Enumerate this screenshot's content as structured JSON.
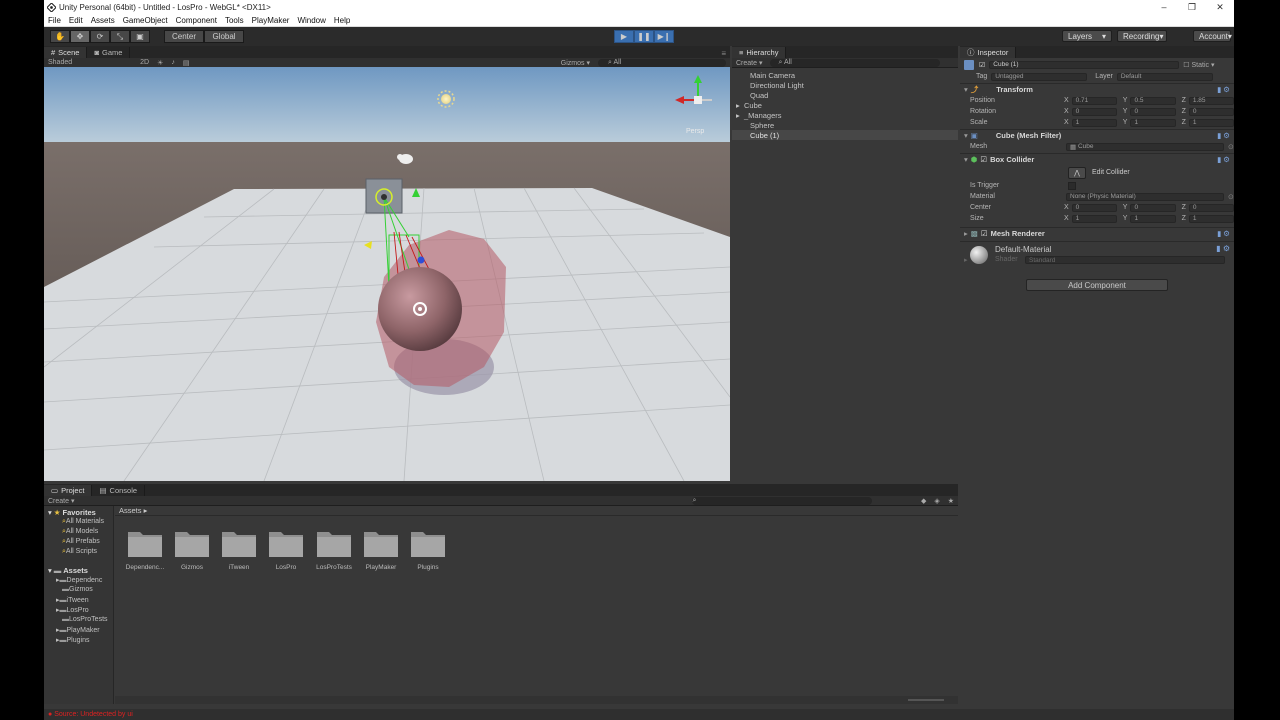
{
  "app": {
    "title": "Unity Personal (64bit) - Untitled - LosPro - WebGL* <DX11>"
  },
  "menu": [
    "File",
    "Edit",
    "Assets",
    "GameObject",
    "Component",
    "Tools",
    "PlayMaker",
    "Window",
    "Help"
  ],
  "toolbar": {
    "pivot_label": "Center",
    "space_label": "Global",
    "layers_label": "Layers",
    "layout_label": "Recording",
    "account_label": "Account"
  },
  "scene_panel": {
    "tab_scene": "Scene",
    "tab_game": "Game",
    "shading": "Shaded",
    "mode_2d": "2D",
    "gizmos_label": "Gizmos",
    "search_text": "All",
    "persp_label": "Persp"
  },
  "hierarchy": {
    "tab": "Hierarchy",
    "create_label": "Create",
    "search_text": "All",
    "items": [
      {
        "label": "Main Camera",
        "arrow": "",
        "selected": false
      },
      {
        "label": "Directional Light",
        "arrow": "",
        "selected": false
      },
      {
        "label": "Quad",
        "arrow": "",
        "selected": false
      },
      {
        "label": "Cube",
        "arrow": "▸",
        "selected": false
      },
      {
        "label": "_Managers",
        "arrow": "▸",
        "selected": false
      },
      {
        "label": "Sphere",
        "arrow": "",
        "selected": false
      },
      {
        "label": "Cube (1)",
        "arrow": "",
        "selected": true
      }
    ]
  },
  "inspector": {
    "tab": "Inspector",
    "object_name": "Cube (1)",
    "static_label": "Static",
    "tag_label": "Tag",
    "tag_value": "Untagged",
    "layer_label": "Layer",
    "layer_value": "Default",
    "transform": {
      "title": "Transform",
      "position_label": "Position",
      "rotation_label": "Rotation",
      "scale_label": "Scale",
      "position": {
        "x": "0.71",
        "y": "0.5",
        "z": "1.85"
      },
      "rotation": {
        "x": "0",
        "y": "0",
        "z": "0"
      },
      "scale": {
        "x": "1",
        "y": "1",
        "z": "1"
      }
    },
    "mesh_filter": {
      "title": "Cube (Mesh Filter)",
      "mesh_label": "Mesh",
      "mesh_value": "Cube"
    },
    "box_collider": {
      "title": "Box Collider",
      "edit_label": "Edit Collider",
      "is_trigger_label": "Is Trigger",
      "material_label": "Material",
      "material_value": "None (Physic Material)",
      "center_label": "Center",
      "size_label": "Size",
      "center": {
        "x": "0",
        "y": "0",
        "z": "0"
      },
      "size": {
        "x": "1",
        "y": "1",
        "z": "1"
      }
    },
    "mesh_renderer": {
      "title": "Mesh Renderer"
    },
    "material": {
      "name": "Default-Material",
      "shader_label": "Shader",
      "shader_value": "Standard"
    },
    "add_component_label": "Add Component",
    "axis_x": "X",
    "axis_y": "Y",
    "axis_z": "Z"
  },
  "project": {
    "tab_project": "Project",
    "tab_console": "Console",
    "create_label": "Create",
    "favorites_label": "Favorites",
    "favorites": [
      "All Materials",
      "All Models",
      "All Prefabs",
      "All Scripts"
    ],
    "assets_label": "Assets",
    "breadcrumb": "Assets",
    "tree": [
      "Dependenc",
      "Gizmos",
      "iTween",
      "LosPro",
      "LosProTests",
      "PlayMaker",
      "Plugins"
    ],
    "folders": [
      "Dependenc...",
      "Gizmos",
      "iTween",
      "LosPro",
      "LosProTests",
      "PlayMaker",
      "Plugins"
    ]
  },
  "status": {
    "text": "Source: Undetected by ui"
  },
  "colors": {
    "panel_bg": "#383838",
    "toolbar_bg": "#2b2b2b",
    "play_blue": "#3a6fb0",
    "sky": "#a8c4d8",
    "ground": "#6c625e",
    "floor": "#d8dbde",
    "sphere": "#8c6468",
    "collider_fill": "#b45a64",
    "error_red": "#d22222"
  }
}
